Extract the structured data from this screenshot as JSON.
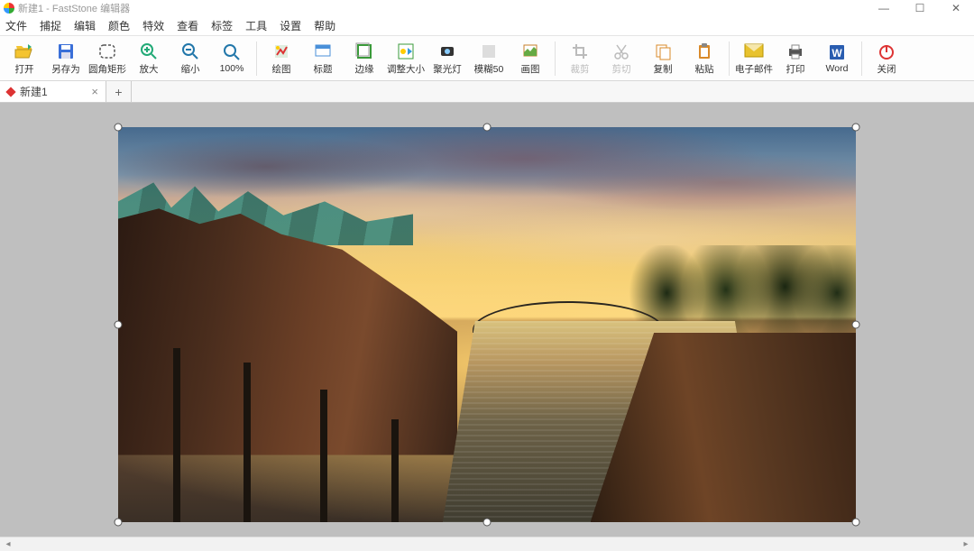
{
  "title": "新建1 - FastStone 编辑器",
  "window_controls": {
    "min": "—",
    "max": "☐",
    "close": "✕"
  },
  "menu": [
    "文件",
    "捕捉",
    "编辑",
    "颜色",
    "特效",
    "查看",
    "标签",
    "工具",
    "设置",
    "帮助"
  ],
  "toolbar": [
    {
      "id": "open",
      "label": "打开",
      "icon": "folder-open-icon",
      "enabled": true,
      "color": "#f4c430"
    },
    {
      "id": "saveas",
      "label": "另存为",
      "icon": "save-icon",
      "enabled": true,
      "color": "#3a6fd8"
    },
    {
      "id": "roundrect",
      "label": "圆角矩形",
      "icon": "rounded-rect-icon",
      "enabled": true,
      "color": "#555"
    },
    {
      "id": "zoomin",
      "label": "放大",
      "icon": "zoom-in-icon",
      "enabled": true,
      "color": "#2a7"
    },
    {
      "id": "zoomout",
      "label": "缩小",
      "icon": "zoom-out-icon",
      "enabled": true,
      "color": "#27a"
    },
    {
      "id": "zoom100",
      "label": "100%",
      "icon": "zoom-100-icon",
      "enabled": true,
      "color": "#27a"
    },
    {
      "sep": true
    },
    {
      "id": "draw",
      "label": "绘图",
      "icon": "draw-icon",
      "enabled": true,
      "color": "#3a9a3a"
    },
    {
      "id": "caption",
      "label": "标题",
      "icon": "caption-icon",
      "enabled": true,
      "color": "#4a90d9"
    },
    {
      "id": "edge",
      "label": "边缘",
      "icon": "edge-icon",
      "enabled": true,
      "color": "#3a9a3a"
    },
    {
      "id": "resize",
      "label": "调整大小",
      "icon": "resize-icon",
      "enabled": true,
      "color": "#3a9a3a"
    },
    {
      "id": "spotlight",
      "label": "聚光灯",
      "icon": "spotlight-icon",
      "enabled": true,
      "color": "#555"
    },
    {
      "id": "blur50",
      "label": "模糊50",
      "icon": "blur-icon",
      "enabled": true,
      "color": "#888"
    },
    {
      "id": "canvas",
      "label": "画图",
      "icon": "canvas-icon",
      "enabled": true,
      "color": "#c77f2a"
    },
    {
      "sep": true
    },
    {
      "id": "crop",
      "label": "裁剪",
      "icon": "crop-icon",
      "enabled": false,
      "color": "#bbb"
    },
    {
      "id": "cut",
      "label": "剪切",
      "icon": "cut-icon",
      "enabled": false,
      "color": "#bbb"
    },
    {
      "id": "copy",
      "label": "复制",
      "icon": "copy-icon",
      "enabled": true,
      "color": "#d98a2a"
    },
    {
      "id": "paste",
      "label": "粘贴",
      "icon": "paste-icon",
      "enabled": true,
      "color": "#d98a2a"
    },
    {
      "sep": true
    },
    {
      "id": "email",
      "label": "电子邮件",
      "icon": "email-icon",
      "enabled": true,
      "color": "#e8c22e"
    },
    {
      "id": "print",
      "label": "打印",
      "icon": "print-icon",
      "enabled": true,
      "color": "#555"
    },
    {
      "id": "word",
      "label": "Word",
      "icon": "word-icon",
      "enabled": true,
      "color": "#2a5db0"
    },
    {
      "sep": true
    },
    {
      "id": "close",
      "label": "关闭",
      "icon": "power-icon",
      "enabled": true,
      "color": "#d33"
    }
  ],
  "tabs": [
    {
      "label": "新建1",
      "modified": true
    }
  ],
  "addtab": "+"
}
